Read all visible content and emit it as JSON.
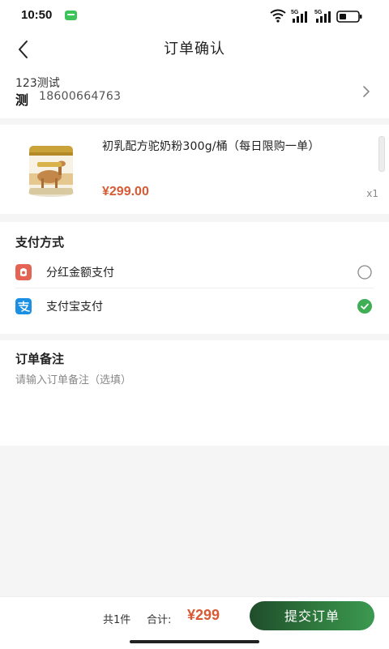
{
  "status_bar": {
    "time": "10:50",
    "signal_label_1": "5G",
    "signal_label_2": "5G"
  },
  "header": {
    "title": "订单确认"
  },
  "address": {
    "name": "123测试",
    "surname_char": "测",
    "phone": "18600664763"
  },
  "product": {
    "name": "初乳配方驼奶粉300g/桶（每日限购一单）",
    "price": "¥299.00",
    "quantity": "x1"
  },
  "payment": {
    "title": "支付方式",
    "methods": [
      {
        "label": "分红金额支付",
        "icon": "dividend-wallet-icon",
        "selected": false
      },
      {
        "label": "支付宝支付",
        "icon": "alipay-icon",
        "selected": true
      }
    ]
  },
  "remark": {
    "title": "订单备注",
    "placeholder": "请输入订单备注（选填）",
    "value": ""
  },
  "footer": {
    "count": "共1件",
    "total_label": "合计:",
    "total_amount": "¥299",
    "submit_label": "提交订单"
  },
  "colors": {
    "price": "#d75a34",
    "accent_green": "#2f7a3e",
    "alipay_blue": "#1a8fe3",
    "dividend_red": "#e56352"
  }
}
